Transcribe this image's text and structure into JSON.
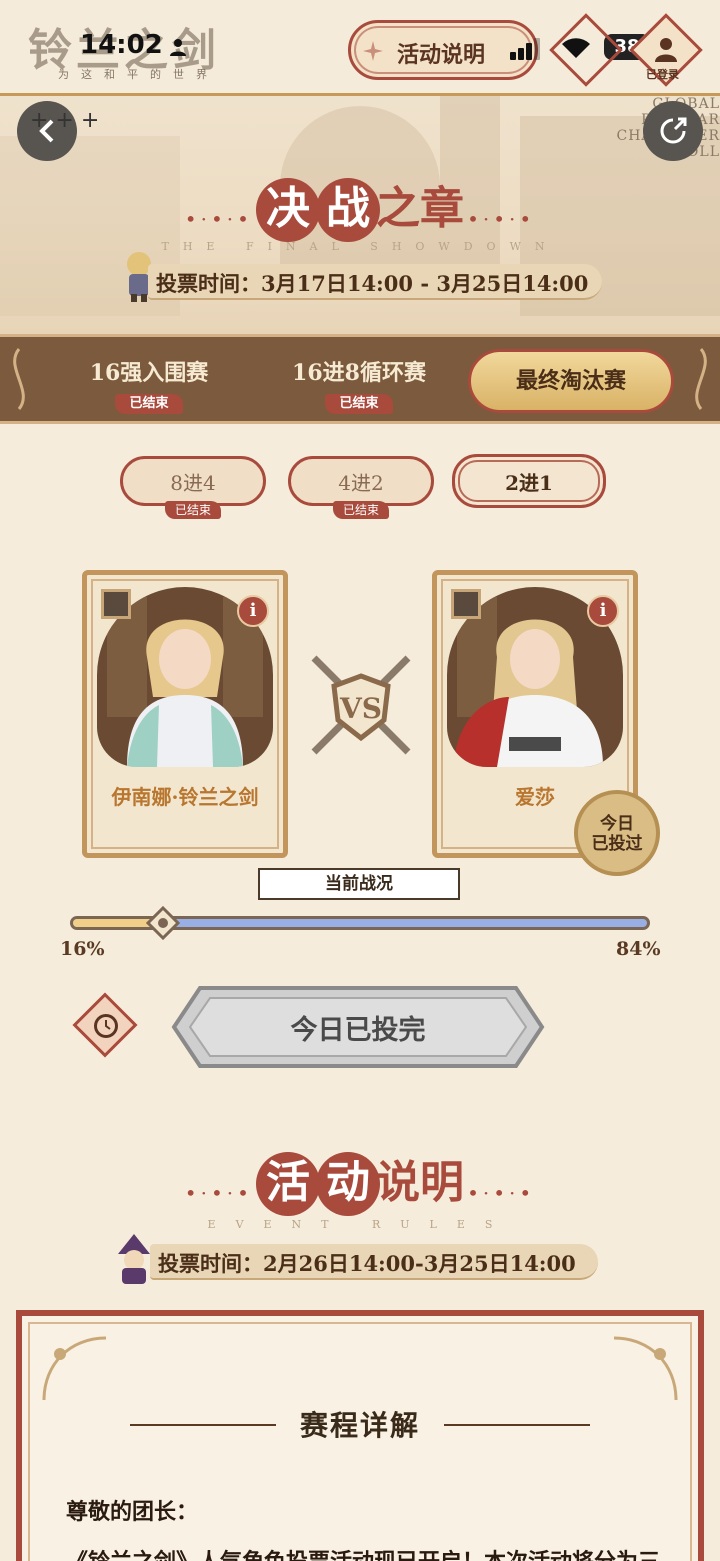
{
  "status_bar": {
    "time": "14:02",
    "battery": "38"
  },
  "header": {
    "logo": "铃兰之剑",
    "logo_sub": "为这和平的世界",
    "rules_button": "活动说明",
    "login_label": "已登录"
  },
  "banner": {
    "global_text": "GLOBAL POPULAR CHARACTER POLL",
    "title_highlight": [
      "决",
      "战"
    ],
    "title_rest": "之章",
    "title_en": "THE FINAL SHOWDOWN",
    "vote_time": "投票时间：3月17日14:00 - 3月25日14:00"
  },
  "stage_tabs": [
    {
      "label": "16强入围赛",
      "status": "已结束"
    },
    {
      "label": "16进8循环赛",
      "status": "已结束"
    },
    {
      "label": "最终淘汰赛",
      "status": ""
    }
  ],
  "round_tabs": [
    {
      "label": "8进4",
      "status": "已结束"
    },
    {
      "label": "4进2",
      "status": "已结束"
    },
    {
      "label": "2进1",
      "status": ""
    }
  ],
  "cards": [
    {
      "name": "伊南娜·铃兰之剑",
      "info": "i"
    },
    {
      "name": "爱莎",
      "info": "i",
      "seal": "今日已投过"
    }
  ],
  "battle": {
    "label": "当前战况",
    "left_pct": "16%",
    "right_pct": "84%",
    "left_value": 0.16
  },
  "vote_button": "今日已投完",
  "rules": {
    "title_highlight": [
      "活",
      "动"
    ],
    "title_rest": "说明",
    "title_en": "EVENT RULES",
    "vote_time": "投票时间：2月26日14:00-3月25日14:00",
    "schedule_title": "赛程详解",
    "greeting": "尊敬的团长：",
    "paragraph": "《铃兰之剑》人气角色投票活动现已开启！本次活动将分为三"
  },
  "colors": {
    "accent": "#a84a3c",
    "gold": "#d9b266",
    "bar_blue": "#9aaee6",
    "bar_yellow": "#f0d088"
  }
}
